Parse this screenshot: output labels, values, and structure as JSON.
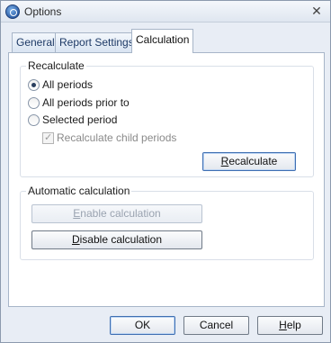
{
  "window": {
    "title": "Options",
    "close_glyph": "✕"
  },
  "tabs": [
    {
      "label": "General"
    },
    {
      "label": "Report Settings"
    },
    {
      "label": "Calculation"
    }
  ],
  "recalculate": {
    "group_label": "Recalculate",
    "options": [
      {
        "label": "All periods",
        "checked": true
      },
      {
        "label": "All periods prior to",
        "checked": false
      },
      {
        "label": "Selected period",
        "checked": false
      }
    ],
    "child_periods": {
      "label": "Recalculate child periods",
      "checked": true,
      "enabled": false
    },
    "button": {
      "prefix": "",
      "accel": "R",
      "rest": "ecalculate"
    }
  },
  "automatic": {
    "group_label": "Automatic calculation",
    "enable_button": {
      "accel": "E",
      "rest": "nable calculation",
      "enabled": false
    },
    "disable_button": {
      "accel": "D",
      "rest": "isable calculation",
      "enabled": true
    }
  },
  "footer": {
    "ok": "OK",
    "cancel": "Cancel",
    "help": {
      "accel": "H",
      "rest": "elp"
    }
  }
}
